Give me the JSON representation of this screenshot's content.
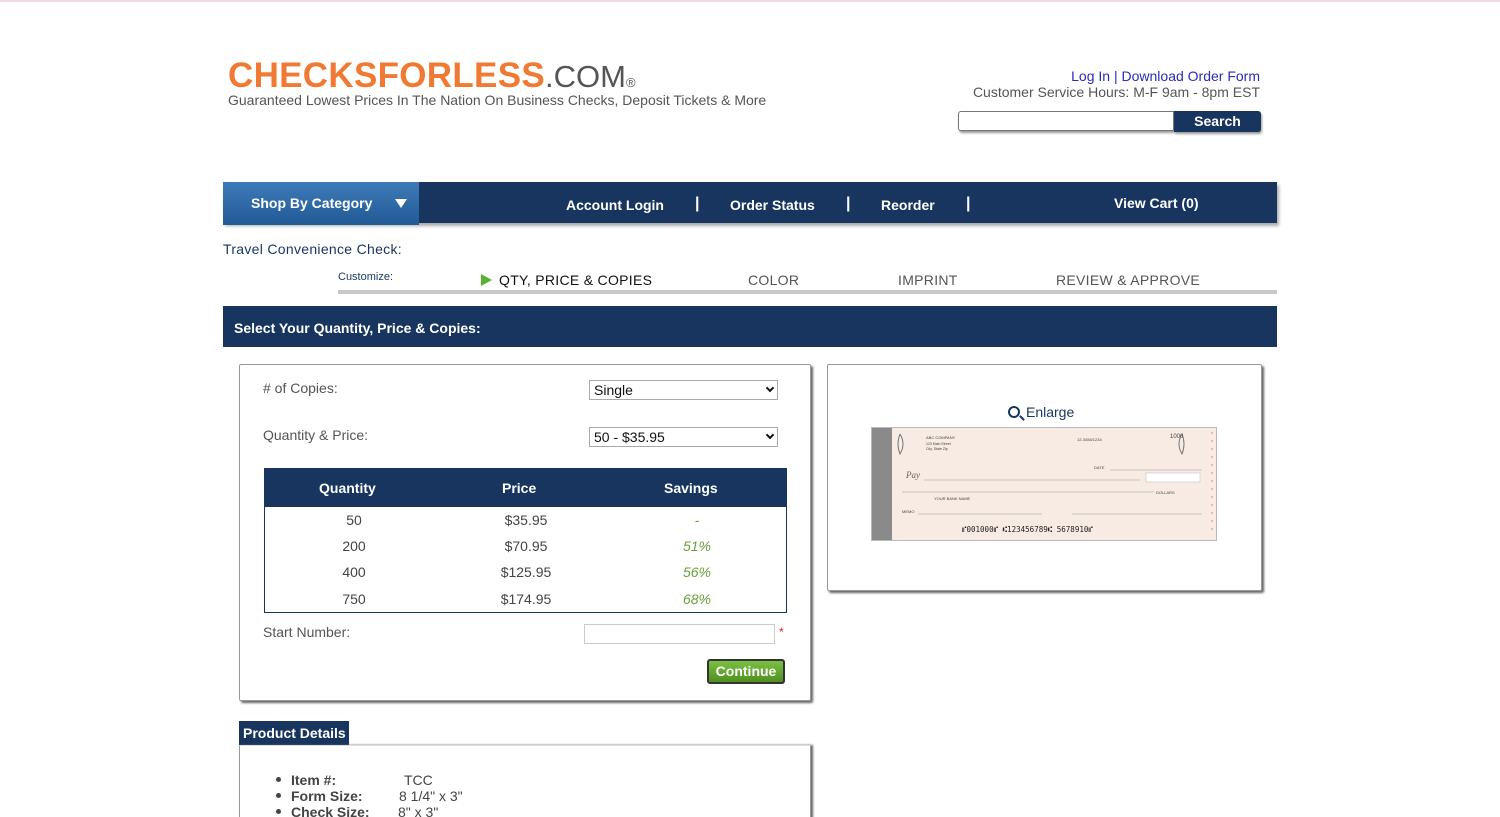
{
  "header": {
    "brand_main": "CHECKSFORLESS",
    "brand_suffix": ".COM",
    "brand_reg": "®",
    "tagline": "Guaranteed Lowest Prices In The Nation On Business Checks, Deposit Tickets & More",
    "login_link": "Log In",
    "link_sep": " | ",
    "download_link": "Download Order Form",
    "hours": "Customer Service Hours: M-F 9am - 8pm EST",
    "search_placeholder": "",
    "search_button": "Search"
  },
  "nav": {
    "shop_by_category": "Shop By Category",
    "account_login": "Account Login",
    "order_status": "Order Status",
    "reorder": "Reorder",
    "view_cart": "View Cart (0)",
    "separator": "|"
  },
  "product": {
    "title": "Travel Convenience Check:"
  },
  "steps": {
    "customize_label": "Customize:",
    "items": [
      "QTY, PRICE & COPIES",
      "COLOR",
      "IMPRINT",
      "REVIEW & APPROVE"
    ],
    "active_index": 0
  },
  "section": {
    "title": "Select Your Quantity, Price & Copies:"
  },
  "form": {
    "copies_label": "# of Copies:",
    "copies_value": "Single",
    "qty_price_label": "Quantity & Price:",
    "qty_price_value": "50 - $35.95",
    "start_number_label": "Start Number:",
    "start_number_value": "",
    "required_mark": "*",
    "continue_button": "Continue"
  },
  "price_table": {
    "headers": [
      "Quantity",
      "Price",
      "Savings"
    ],
    "rows": [
      {
        "quantity": "50",
        "price": "$35.95",
        "savings": "-"
      },
      {
        "quantity": "200",
        "price": "$70.95",
        "savings": "51%"
      },
      {
        "quantity": "400",
        "price": "$125.95",
        "savings": "56%"
      },
      {
        "quantity": "750",
        "price": "$174.95",
        "savings": "68%"
      }
    ]
  },
  "preview": {
    "enlarge_label": "Enlarge",
    "check": {
      "company": "ABC COMPANY",
      "address1": "123 Main Street",
      "address2": "City, State Zip",
      "fraction": "12-3456/1234",
      "number": "1000",
      "date_label": "DATE",
      "pay_label": "Pay",
      "bank": "YOUR BANK NAME",
      "memo_label": "MEMO",
      "dollars_label": "DOLLARS",
      "micr": "⑈001000⑈ ⑆123456789⑆ 5678910⑈"
    },
    "colors": {
      "check_background": "#f7ebe3",
      "stub": "#8a8a8a"
    }
  },
  "details": {
    "tab_label": "Product Details",
    "items": [
      {
        "label": "Item #:",
        "value": "TCC"
      },
      {
        "label": "Form Size:",
        "value": "8 1/4\" x 3\""
      },
      {
        "label": "Check Size:",
        "value": "8\" x 3\""
      }
    ]
  },
  "colors": {
    "navy": "#17355f",
    "orange": "#f07a33",
    "green": "#58b331",
    "link_blue": "#2a2ab8"
  }
}
